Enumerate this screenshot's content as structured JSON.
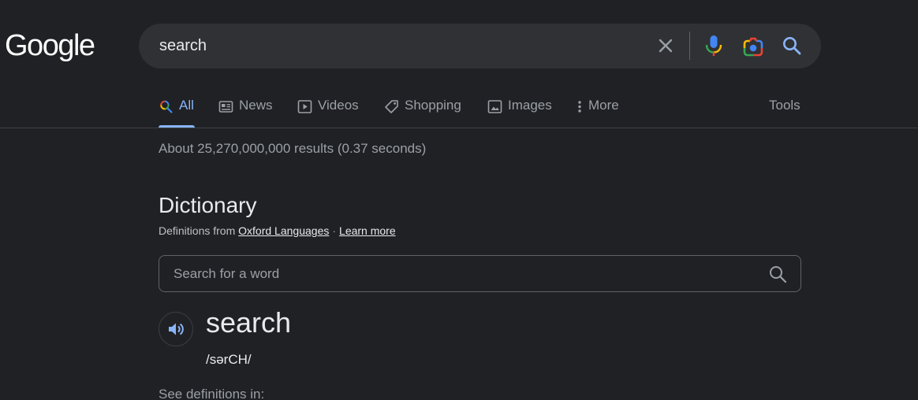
{
  "logo": {
    "text": "Google"
  },
  "search": {
    "query": "search",
    "icons": {
      "clear": "close-icon",
      "voice": "microphone-icon",
      "lens": "google-lens-icon",
      "submit": "magnifier-icon"
    }
  },
  "tabs": [
    {
      "label": "All",
      "icon": "multicolor-search-icon",
      "active": true
    },
    {
      "label": "News",
      "icon": "newspaper-icon",
      "active": false
    },
    {
      "label": "Videos",
      "icon": "play-icon",
      "active": false
    },
    {
      "label": "Shopping",
      "icon": "tag-icon",
      "active": false
    },
    {
      "label": "Images",
      "icon": "image-icon",
      "active": false
    },
    {
      "label": "More",
      "icon": "vertical-dots-icon",
      "active": false
    }
  ],
  "tools_label": "Tools",
  "result_stats": "About 25,270,000,000 results (0.37 seconds)",
  "dictionary": {
    "title": "Dictionary",
    "source_prefix": "Definitions from",
    "source_link": "Oxford Languages",
    "separator": "·",
    "learn_more": "Learn more",
    "search_placeholder": "Search for a word",
    "word": "search",
    "pronunciation": "/sərCH/",
    "see_definitions": "See definitions in:"
  },
  "colors": {
    "background": "#202124",
    "surface": "#303134",
    "accent": "#8ab4f8",
    "text_primary": "#e8eaed",
    "text_secondary": "#9aa0a6",
    "google_blue": "#4285f4",
    "google_red": "#ea4335",
    "google_yellow": "#fbbc05",
    "google_green": "#34a853"
  }
}
